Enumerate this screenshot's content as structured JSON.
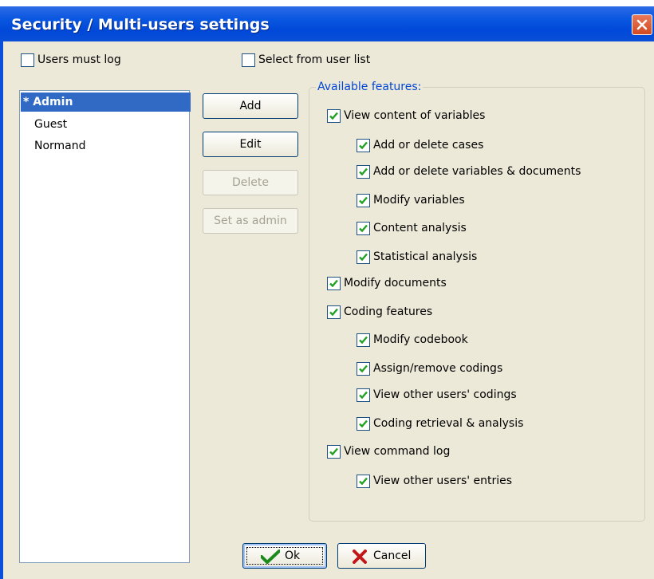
{
  "window": {
    "title": "Security / Multi-users settings",
    "close_icon": "close-icon"
  },
  "options": {
    "users_must_log": {
      "label": "Users must log",
      "checked": false
    },
    "select_from_user_list": {
      "label": "Select from user list",
      "checked": false
    }
  },
  "users": [
    {
      "label": "* Admin",
      "selected": true
    },
    {
      "label": "Guest",
      "selected": false
    },
    {
      "label": "Normand",
      "selected": false
    }
  ],
  "user_buttons": {
    "add": {
      "label": "Add",
      "enabled": true
    },
    "edit": {
      "label": "Edit",
      "enabled": true
    },
    "delete": {
      "label": "Delete",
      "enabled": false
    },
    "set_admin": {
      "label": "Set as admin",
      "enabled": false
    }
  },
  "features": {
    "group_label": "Available features:",
    "items": [
      {
        "label": "View content of variables",
        "checked": true,
        "level": 0
      },
      {
        "label": "Add or delete cases",
        "checked": true,
        "level": 1
      },
      {
        "label": "Add or delete variables & documents",
        "checked": true,
        "level": 1
      },
      {
        "label": "Modify variables",
        "checked": true,
        "level": 1
      },
      {
        "label": "Content analysis",
        "checked": true,
        "level": 1
      },
      {
        "label": "Statistical analysis",
        "checked": true,
        "level": 1
      },
      {
        "label": "Modify documents",
        "checked": true,
        "level": 0
      },
      {
        "label": "Coding features",
        "checked": true,
        "level": 0
      },
      {
        "label": "Modify codebook",
        "checked": true,
        "level": 1
      },
      {
        "label": "Assign/remove codings",
        "checked": true,
        "level": 1
      },
      {
        "label": "View other users' codings",
        "checked": true,
        "level": 1
      },
      {
        "label": "Coding retrieval & analysis",
        "checked": true,
        "level": 1
      },
      {
        "label": "View command log",
        "checked": true,
        "level": 0
      },
      {
        "label": "View other users' entries",
        "checked": true,
        "level": 1
      }
    ]
  },
  "dialog_buttons": {
    "ok": {
      "label": "Ok",
      "icon": "checkmark-icon"
    },
    "cancel": {
      "label": "Cancel",
      "icon": "x-icon"
    }
  },
  "colors": {
    "titlebar": "#0a57e0",
    "selection": "#316ac5",
    "check": "#21a121",
    "group_label": "#0046d5"
  }
}
